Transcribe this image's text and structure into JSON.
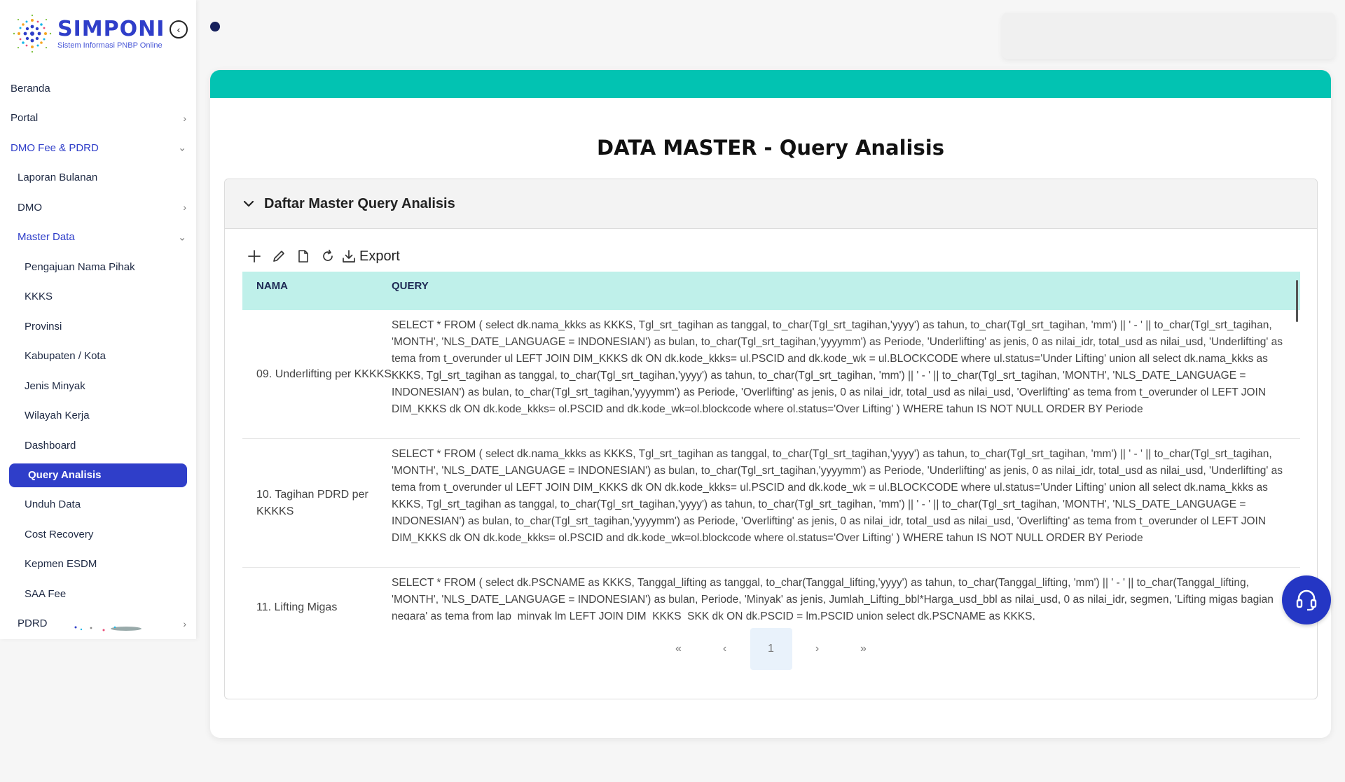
{
  "brand": {
    "title": "SIMPONI",
    "subtitle": "Sistem Informasi PNBP Online"
  },
  "sidebar": {
    "items": [
      {
        "label": "Beranda",
        "level": 0
      },
      {
        "label": "Portal",
        "level": 0,
        "chevron": "right"
      },
      {
        "label": "DMO Fee & PDRD",
        "level": 0,
        "chevron": "down",
        "color": "#2f3ec9"
      },
      {
        "label": "Laporan Bulanan",
        "level": 1
      },
      {
        "label": "DMO",
        "level": 1,
        "chevron": "right"
      },
      {
        "label": "Master Data",
        "level": 1,
        "chevron": "down",
        "color": "#2f3ec9"
      },
      {
        "label": "Pengajuan Nama Pihak",
        "level": 2
      },
      {
        "label": "KKKS",
        "level": 2
      },
      {
        "label": "Provinsi",
        "level": 2
      },
      {
        "label": "Kabupaten / Kota",
        "level": 2
      },
      {
        "label": "Jenis Minyak",
        "level": 2
      },
      {
        "label": "Wilayah Kerja",
        "level": 2
      },
      {
        "label": "Dashboard",
        "level": 2
      },
      {
        "label": "Query Analisis",
        "level": 2,
        "active": true
      },
      {
        "label": "Unduh Data",
        "level": 2
      },
      {
        "label": "Cost Recovery",
        "level": 2
      },
      {
        "label": "Kepmen ESDM",
        "level": 2
      },
      {
        "label": "SAA Fee",
        "level": 2
      },
      {
        "label": "PDRD",
        "level": 1,
        "chevron": "right"
      }
    ]
  },
  "page": {
    "title": "DATA MASTER - Query Analisis"
  },
  "panel": {
    "title": "Daftar Master Query Analisis",
    "toolbar": {
      "export_label": "Export",
      "icons": [
        "plus-icon",
        "pencil-icon",
        "file-icon",
        "refresh-icon",
        "download-icon"
      ]
    }
  },
  "table": {
    "columns": [
      "NAMA",
      "QUERY"
    ],
    "rows": [
      {
        "nama": "09. Underlifting per KKKKS",
        "query": "SELECT * FROM ( select  dk.nama_kkks as KKKS,  Tgl_srt_tagihan as tanggal,  to_char(Tgl_srt_tagihan,'yyyy') as tahun,  to_char(Tgl_srt_tagihan, 'mm') || ' - ' || to_char(Tgl_srt_tagihan, 'MONTH', 'NLS_DATE_LANGUAGE = INDONESIAN') as bulan,  to_char(Tgl_srt_tagihan,'yyyymm') as Periode,  'Underlifting' as jenis,  0 as nilai_idr, total_usd as nilai_usd, 'Underlifting' as tema  from t_overunder ul LEFT JOIN DIM_KKKS dk ON dk.kode_kkks= ul.PSCID and dk.kode_wk = ul.BLOCKCODE where ul.status='Under Lifting' union all select  dk.nama_kkks as KKKS,  Tgl_srt_tagihan as tanggal,  to_char(Tgl_srt_tagihan,'yyyy') as tahun,  to_char(Tgl_srt_tagihan, 'mm') || ' - ' || to_char(Tgl_srt_tagihan, 'MONTH', 'NLS_DATE_LANGUAGE = INDONESIAN') as bulan,  to_char(Tgl_srt_tagihan,'yyyymm') as Periode,  'Overlifting' as jenis,  0 as nilai_idr, total_usd as nilai_usd,  'Overlifting' as tema  from t_overunder ol LEFT JOIN DIM_KKKS dk ON dk.kode_kkks= ol.PSCID and dk.kode_wk=ol.blockcode where ol.status='Over Lifting' ) WHERE tahun IS NOT NULL ORDER BY Periode"
      },
      {
        "nama": "10. Tagihan PDRD per KKKKS",
        "query": "SELECT * FROM ( select  dk.nama_kkks as KKKS,  Tgl_srt_tagihan as tanggal,  to_char(Tgl_srt_tagihan,'yyyy') as tahun,  to_char(Tgl_srt_tagihan, 'mm') || ' - ' || to_char(Tgl_srt_tagihan, 'MONTH', 'NLS_DATE_LANGUAGE = INDONESIAN') as bulan,  to_char(Tgl_srt_tagihan,'yyyymm') as Periode,  'Underlifting' as jenis,  0 as nilai_idr, total_usd as nilai_usd, 'Underlifting' as tema  from t_overunder ul LEFT JOIN DIM_KKKS dk ON dk.kode_kkks= ul.PSCID and dk.kode_wk = ul.BLOCKCODE where ul.status='Under Lifting' union all select  dk.nama_kkks as KKKS,  Tgl_srt_tagihan as tanggal,  to_char(Tgl_srt_tagihan,'yyyy') as tahun,  to_char(Tgl_srt_tagihan, 'mm') || ' - ' || to_char(Tgl_srt_tagihan, 'MONTH', 'NLS_DATE_LANGUAGE = INDONESIAN') as bulan,  to_char(Tgl_srt_tagihan,'yyyymm') as Periode,  'Overlifting' as jenis,  0 as nilai_idr, total_usd as nilai_usd,  'Overlifting' as tema  from t_overunder ol LEFT JOIN DIM_KKKS dk ON dk.kode_kkks= ol.PSCID and dk.kode_wk=ol.blockcode where ol.status='Over Lifting' ) WHERE tahun IS NOT NULL ORDER BY Periode"
      },
      {
        "nama": "11. Lifting Migas",
        "query": "SELECT * FROM ( select  dk.PSCNAME as KKKS,  Tanggal_lifting as tanggal,  to_char(Tanggal_lifting,'yyyy') as tahun,  to_char(Tanggal_lifting, 'mm') || ' - ' || to_char(Tanggal_lifting, 'MONTH', 'NLS_DATE_LANGUAGE = INDONESIAN') as bulan,  Periode, 'Minyak' as jenis,  Jumlah_Lifting_bbl*Harga_usd_bbl as nilai_usd,  0 as nilai_idr,  segmen, 'Lifting migas bagian negara' as tema  from lap_minyak lm LEFT JOIN DIM_KKKS_SKK dk ON dk.PSCID = lm.PSCID union  select  dk.PSCNAME as KKKS,"
      }
    ]
  },
  "pagination": {
    "first": "«",
    "prev": "‹",
    "current": "1",
    "next": "›",
    "last": "»"
  },
  "colors": {
    "accent": "#2f3ec9",
    "band": "#02c3b2",
    "header_row": "#bff0ea"
  }
}
